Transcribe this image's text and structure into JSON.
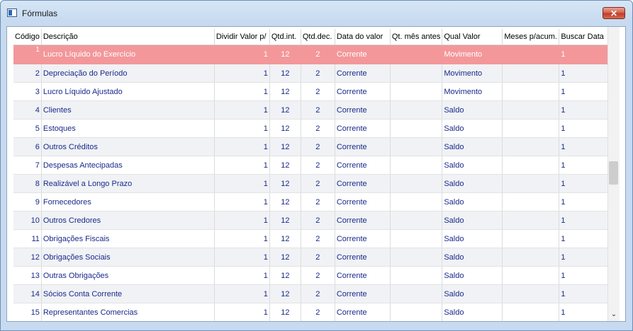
{
  "window": {
    "title": "Fórmulas",
    "close_label": "✕"
  },
  "columns": [
    "Código",
    "Descrição",
    "Dividir Valor p/",
    "Qtd.int.",
    "Qtd.dec.",
    "Data do valor",
    "Qt. mês antes",
    "Qual Valor",
    "Meses p/acum.",
    "Buscar Data"
  ],
  "rows": [
    {
      "codigo": "1",
      "descricao": "Lucro Líquido do Exercício",
      "dividir": "1",
      "qtd_int": "12",
      "qtd_dec": "2",
      "data_valor": "Corrente",
      "qt_mes_antes": "",
      "qual_valor": "Movimento",
      "meses_acum": "",
      "buscar_data": "1"
    },
    {
      "codigo": "2",
      "descricao": "Depreciação do Período",
      "dividir": "1",
      "qtd_int": "12",
      "qtd_dec": "2",
      "data_valor": "Corrente",
      "qt_mes_antes": "",
      "qual_valor": "Movimento",
      "meses_acum": "",
      "buscar_data": "1"
    },
    {
      "codigo": "3",
      "descricao": "Lucro Líquido Ajustado",
      "dividir": "1",
      "qtd_int": "12",
      "qtd_dec": "2",
      "data_valor": "Corrente",
      "qt_mes_antes": "",
      "qual_valor": "Movimento",
      "meses_acum": "",
      "buscar_data": "1"
    },
    {
      "codigo": "4",
      "descricao": "Clientes",
      "dividir": "1",
      "qtd_int": "12",
      "qtd_dec": "2",
      "data_valor": "Corrente",
      "qt_mes_antes": "",
      "qual_valor": "Saldo",
      "meses_acum": "",
      "buscar_data": "1"
    },
    {
      "codigo": "5",
      "descricao": "Estoques",
      "dividir": "1",
      "qtd_int": "12",
      "qtd_dec": "2",
      "data_valor": "Corrente",
      "qt_mes_antes": "",
      "qual_valor": "Saldo",
      "meses_acum": "",
      "buscar_data": "1"
    },
    {
      "codigo": "6",
      "descricao": "Outros Créditos",
      "dividir": "1",
      "qtd_int": "12",
      "qtd_dec": "2",
      "data_valor": "Corrente",
      "qt_mes_antes": "",
      "qual_valor": "Saldo",
      "meses_acum": "",
      "buscar_data": "1"
    },
    {
      "codigo": "7",
      "descricao": "Despesas Antecipadas",
      "dividir": "1",
      "qtd_int": "12",
      "qtd_dec": "2",
      "data_valor": "Corrente",
      "qt_mes_antes": "",
      "qual_valor": "Saldo",
      "meses_acum": "",
      "buscar_data": "1"
    },
    {
      "codigo": "8",
      "descricao": "Realizável a Longo Prazo",
      "dividir": "1",
      "qtd_int": "12",
      "qtd_dec": "2",
      "data_valor": "Corrente",
      "qt_mes_antes": "",
      "qual_valor": "Saldo",
      "meses_acum": "",
      "buscar_data": "1"
    },
    {
      "codigo": "9",
      "descricao": "Fornecedores",
      "dividir": "1",
      "qtd_int": "12",
      "qtd_dec": "2",
      "data_valor": "Corrente",
      "qt_mes_antes": "",
      "qual_valor": "Saldo",
      "meses_acum": "",
      "buscar_data": "1"
    },
    {
      "codigo": "10",
      "descricao": "Outros Credores",
      "dividir": "1",
      "qtd_int": "12",
      "qtd_dec": "2",
      "data_valor": "Corrente",
      "qt_mes_antes": "",
      "qual_valor": "Saldo",
      "meses_acum": "",
      "buscar_data": "1"
    },
    {
      "codigo": "11",
      "descricao": "Obrigações Fiscais",
      "dividir": "1",
      "qtd_int": "12",
      "qtd_dec": "2",
      "data_valor": "Corrente",
      "qt_mes_antes": "",
      "qual_valor": "Saldo",
      "meses_acum": "",
      "buscar_data": "1"
    },
    {
      "codigo": "12",
      "descricao": "Obrigações Sociais",
      "dividir": "1",
      "qtd_int": "12",
      "qtd_dec": "2",
      "data_valor": "Corrente",
      "qt_mes_antes": "",
      "qual_valor": "Saldo",
      "meses_acum": "",
      "buscar_data": "1"
    },
    {
      "codigo": "13",
      "descricao": "Outras Obrigações",
      "dividir": "1",
      "qtd_int": "12",
      "qtd_dec": "2",
      "data_valor": "Corrente",
      "qt_mes_antes": "",
      "qual_valor": "Saldo",
      "meses_acum": "",
      "buscar_data": "1"
    },
    {
      "codigo": "14",
      "descricao": "Sócios Conta Corrente",
      "dividir": "1",
      "qtd_int": "12",
      "qtd_dec": "2",
      "data_valor": "Corrente",
      "qt_mes_antes": "",
      "qual_valor": "Saldo",
      "meses_acum": "",
      "buscar_data": "1"
    },
    {
      "codigo": "15",
      "descricao": "Representantes Comercias",
      "dividir": "1",
      "qtd_int": "12",
      "qtd_dec": "2",
      "data_valor": "Corrente",
      "qt_mes_antes": "",
      "qual_valor": "Saldo",
      "meses_acum": "",
      "buscar_data": "1"
    }
  ],
  "selected_row_color": "#f3979a",
  "scroll_down_glyph": "⌄"
}
